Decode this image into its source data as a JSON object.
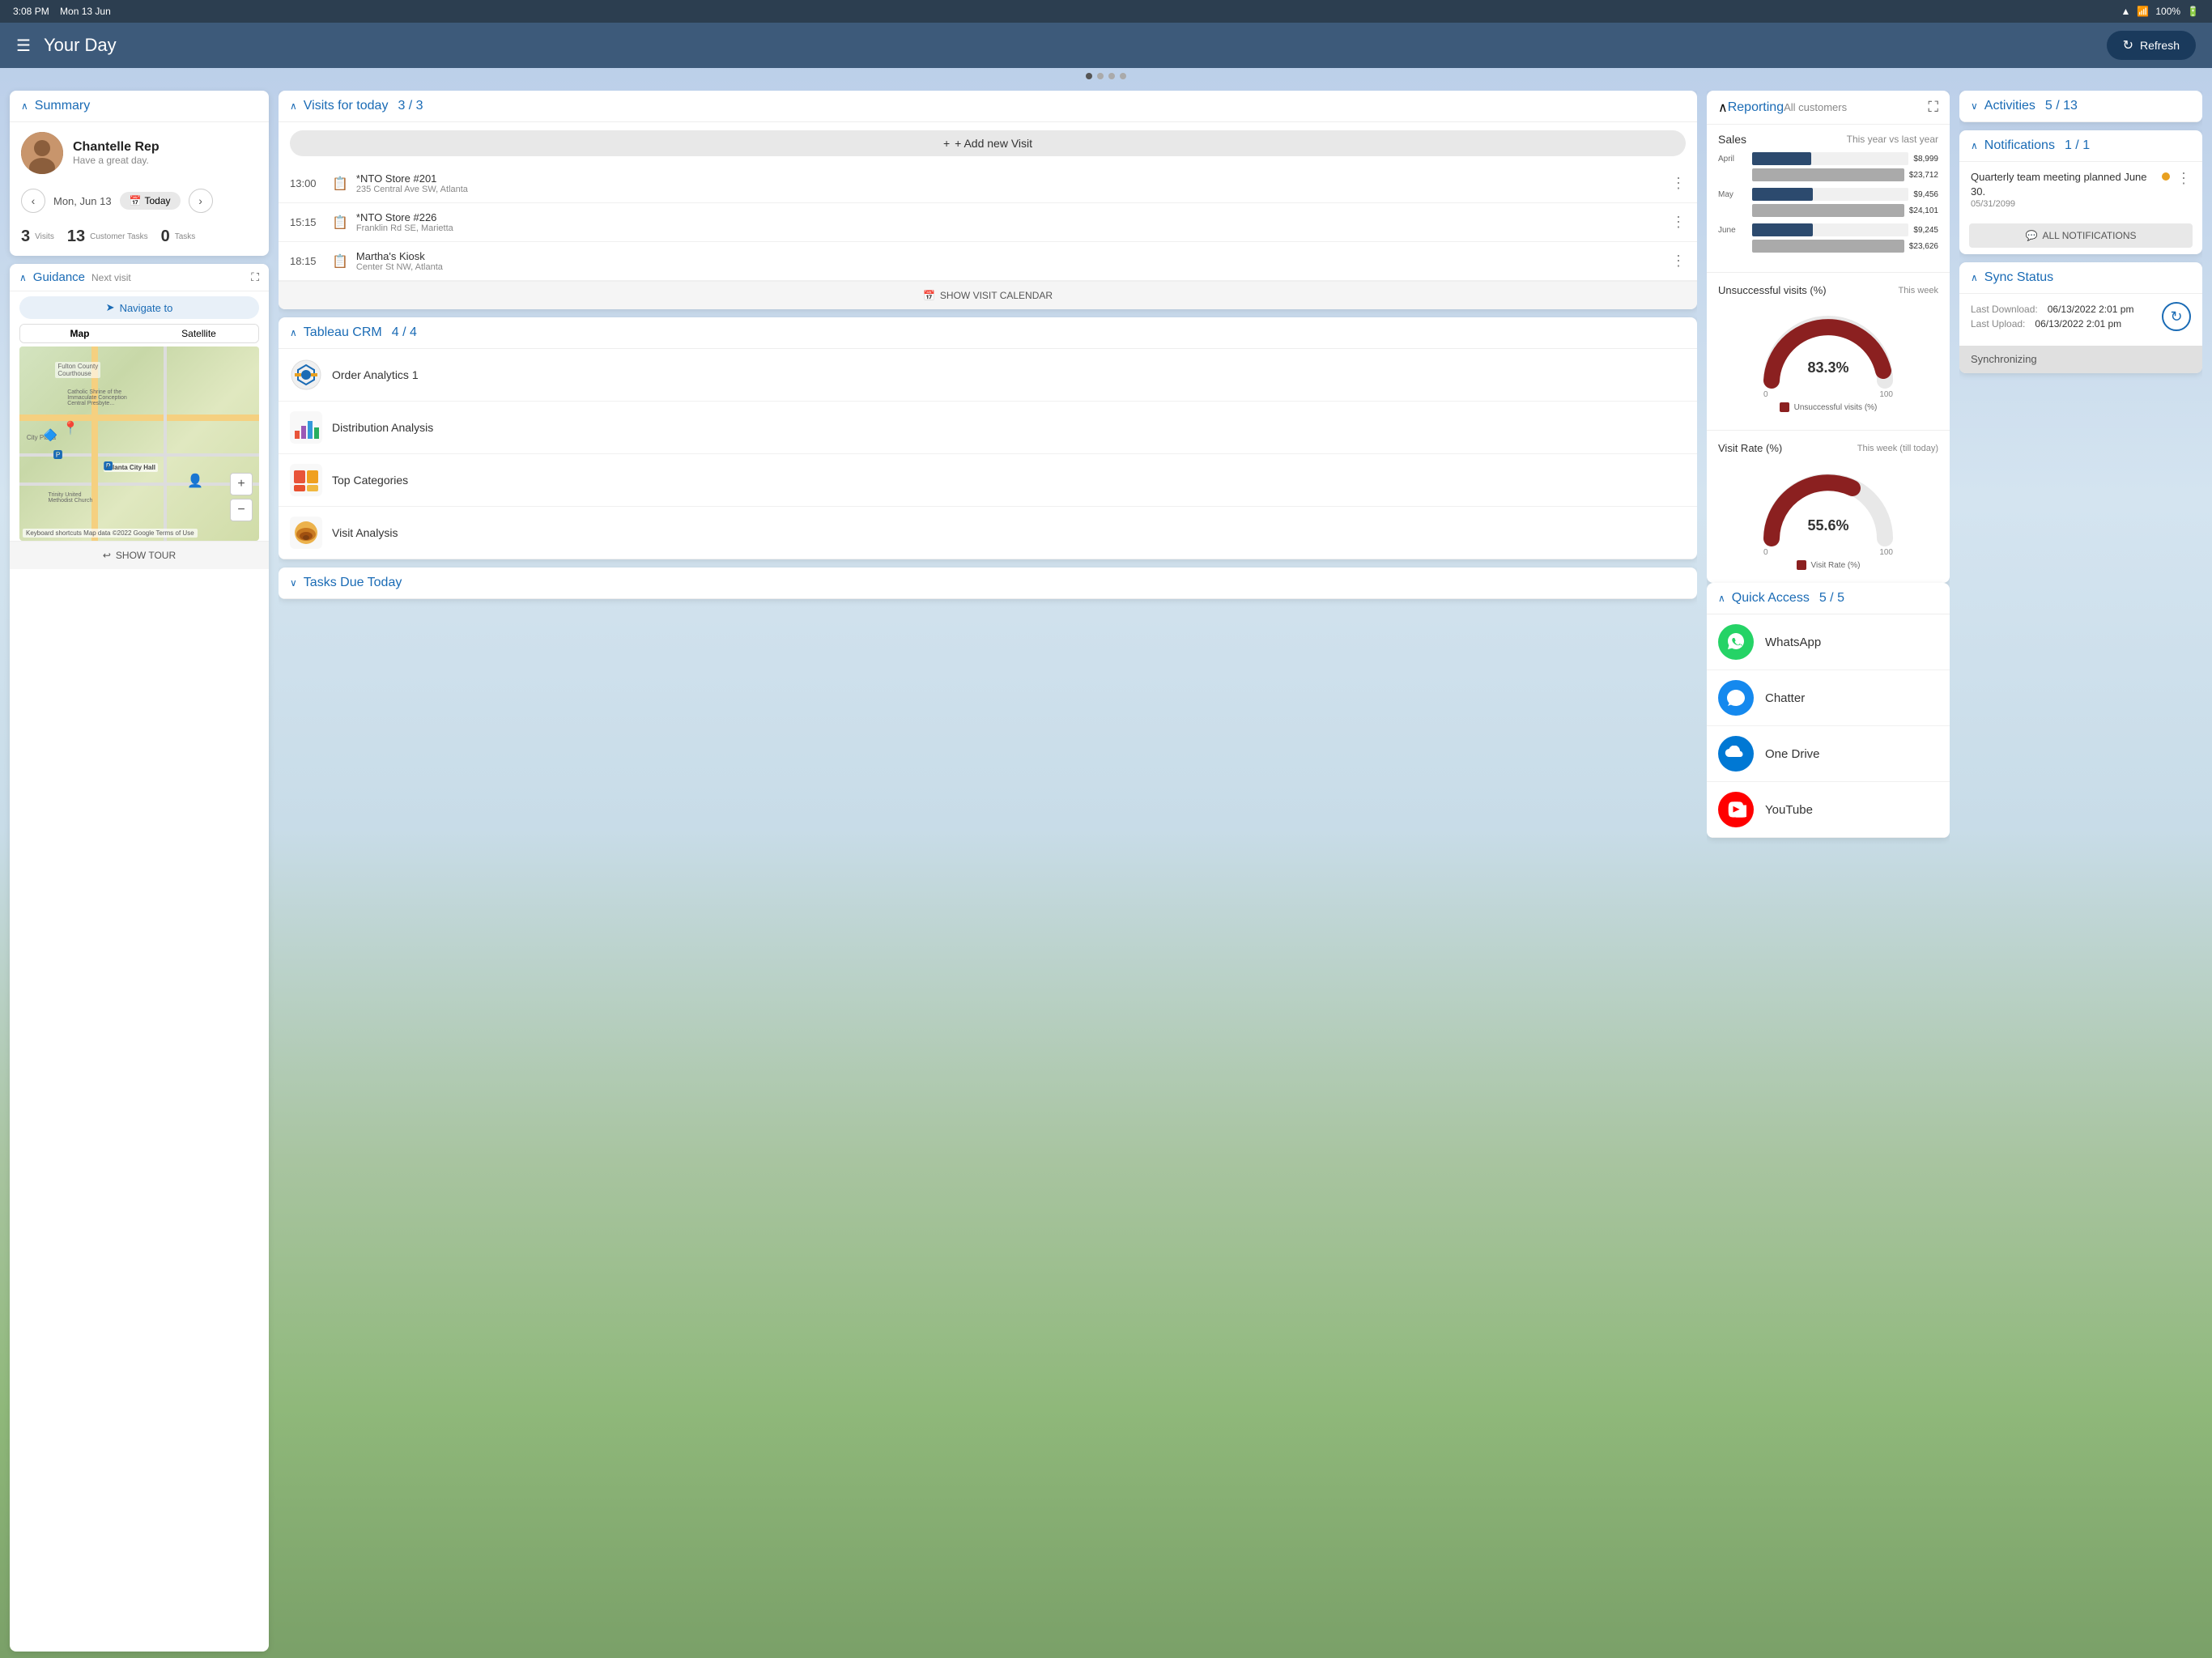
{
  "statusBar": {
    "time": "3:08 PM",
    "date": "Mon 13 Jun",
    "battery": "100%",
    "batteryIcon": "🔋"
  },
  "topNav": {
    "title": "Your Day",
    "refreshLabel": "Refresh",
    "hamburgerIcon": "☰"
  },
  "pagination": {
    "dots": [
      true,
      false,
      false,
      false
    ]
  },
  "summary": {
    "sectionLabel": "Summary",
    "userName": "Chantelle Rep",
    "userGreeting": "Have a great day.",
    "dateLabel": "Mon, Jun 13",
    "todayLabel": "Today",
    "visitsCount": "3",
    "visitsLabel": "Visits",
    "tasksCount1": "13",
    "tasksLabel1": "Customer Tasks",
    "tasksCount2": "0",
    "tasksLabel2": "Tasks"
  },
  "guidance": {
    "sectionLabel": "Guidance",
    "subtitle": "Next visit",
    "navigateLabel": "Navigate to",
    "mapTab1": "Map",
    "mapTab2": "Satellite",
    "showTourLabel": "SHOW TOUR",
    "mapAttribution": "Keyboard shortcuts   Map data ©2022 Google   Terms of Use"
  },
  "visits": {
    "sectionLabel": "Visits for today",
    "count": "3 / 3",
    "addVisitLabel": "+ Add new Visit",
    "showCalendarLabel": "SHOW VISIT CALENDAR",
    "items": [
      {
        "time": "13:00",
        "name": "*NTO Store #201",
        "address": "235 Central Ave SW, Atlanta"
      },
      {
        "time": "15:15",
        "name": "*NTO Store #226",
        "address": "Franklin Rd SE, Marietta"
      },
      {
        "time": "18:15",
        "name": "Martha's Kiosk",
        "address": "Center St NW, Atlanta"
      }
    ]
  },
  "tableauCRM": {
    "sectionLabel": "Tableau CRM",
    "count": "4 / 4",
    "items": [
      {
        "label": "Order Analytics 1"
      },
      {
        "label": "Distribution Analysis"
      },
      {
        "label": "Top Categories"
      },
      {
        "label": "Visit Analysis"
      }
    ]
  },
  "tasksDueToday": {
    "sectionLabel": "Tasks Due Today"
  },
  "reporting": {
    "sectionLabel": "Reporting",
    "subtitle": "All customers",
    "salesLabel": "Sales",
    "salesPeriod": "This year vs last year",
    "bars": [
      {
        "month": "April",
        "current": "$8,999",
        "prev": "$23,712",
        "currentPct": 38,
        "prevPct": 100
      },
      {
        "month": "May",
        "current": "$9,456",
        "prev": "$24,101",
        "currentPct": 39,
        "prevPct": 100
      },
      {
        "month": "June",
        "current": "$9,245",
        "prev": "$23,626",
        "currentPct": 39,
        "prevPct": 100
      }
    ],
    "gauges": [
      {
        "label": "Unsuccessful visits (%)",
        "period": "This week",
        "value": "83.3%",
        "valuePct": 83.3,
        "legendLabel": "Unsuccessful visits (%)"
      },
      {
        "label": "Visit Rate (%)",
        "period": "This week (till today)",
        "value": "55.6%",
        "valuePct": 55.6,
        "legendLabel": "Visit Rate (%)"
      }
    ]
  },
  "quickAccess": {
    "sectionLabel": "Quick Access",
    "count": "5 / 5",
    "items": [
      {
        "label": "WhatsApp",
        "color": "#25d366",
        "icon": "💬"
      },
      {
        "label": "Chatter",
        "color": "#1589ee",
        "icon": "☁"
      },
      {
        "label": "One Drive",
        "color": "#0078d4",
        "icon": "☁"
      },
      {
        "label": "YouTube",
        "color": "#ff0000",
        "icon": "▶"
      }
    ]
  },
  "activities": {
    "sectionLabel": "Activities",
    "count": "5 / 13"
  },
  "notifications": {
    "sectionLabel": "Notifications",
    "count": "1 / 1",
    "item": {
      "text": "Quarterly team meeting planned June 30.",
      "date": "05/31/2099"
    },
    "allNotificationsLabel": "ALL NOTIFICATIONS"
  },
  "syncStatus": {
    "sectionLabel": "Sync Status",
    "lastDownloadLabel": "Last Download:",
    "lastDownloadValue": "06/13/2022 2:01 pm",
    "lastUploadLabel": "Last Upload:",
    "lastUploadValue": "06/13/2022 2:01 pm",
    "statusLabel": "Synchronizing"
  }
}
